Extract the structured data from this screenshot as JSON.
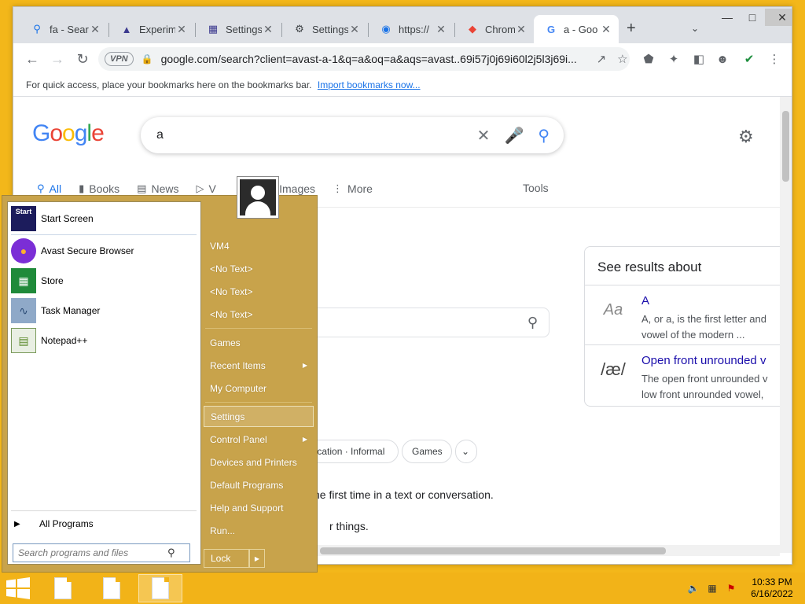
{
  "browser": {
    "tabs": [
      {
        "title": "fa - Sear",
        "icon": "search-icon"
      },
      {
        "title": "Experim",
        "icon": "flask-icon"
      },
      {
        "title": "Settings",
        "icon": "settings-page-icon"
      },
      {
        "title": "Settings",
        "icon": "gear-icon"
      },
      {
        "title": "https://",
        "icon": "globe-icon"
      },
      {
        "title": "Chrome",
        "icon": "chrome-store-icon"
      },
      {
        "title": "a - Goo",
        "icon": "google-icon"
      }
    ],
    "url": "google.com/search?client=avast-a-1&q=a&oq=a&aqs=avast..69i57j0j69i60l2j5l3j69i...",
    "vpn_label": "VPN",
    "bookmark_bar_text": "For quick access, place your bookmarks here on the bookmarks bar.",
    "bookmark_bar_link": "Import bookmarks now..."
  },
  "google": {
    "logo": [
      "G",
      "o",
      "o",
      "g",
      "l",
      "e"
    ],
    "logo_colors": [
      "#4285f4",
      "#ea4335",
      "#fbbc05",
      "#4285f4",
      "#34a853",
      "#ea4335"
    ],
    "query": "a",
    "tabs": [
      {
        "label": "All",
        "icon": "search-icon"
      },
      {
        "label": "Books",
        "icon": "book-icon"
      },
      {
        "label": "News",
        "icon": "news-icon"
      },
      {
        "label": "V",
        "icon": "video-icon"
      },
      {
        "label": "Images",
        "icon": "image-icon"
      },
      {
        "label": "More",
        "icon": "more-vert-icon"
      }
    ],
    "tools": "Tools",
    "knowledge_panel": {
      "title": "See results about",
      "items": [
        {
          "name": "A",
          "desc1": "A, or a, is the first letter and",
          "desc2": "vowel of the modern ...",
          "thumb": "Aa"
        },
        {
          "name": "Open front unrounded v",
          "desc1": "The open front unrounded v",
          "desc2": "low front unrounded vowel,",
          "thumb": "/æ/"
        }
      ]
    },
    "chips": [
      {
        "label": "Education · Informal"
      },
      {
        "label": "Games"
      }
    ],
    "text_lines": [
      "he first time in a text or conversation.",
      "r things."
    ]
  },
  "startmenu": {
    "pinned": [
      {
        "label": "Start Screen",
        "icon": "start-screen-icon",
        "badge": "Start"
      },
      {
        "label": "Avast Secure Browser",
        "icon": "avast-browser-icon"
      },
      {
        "label": "Store",
        "icon": "store-icon"
      },
      {
        "label": "Task Manager",
        "icon": "task-manager-icon"
      },
      {
        "label": "Notepad++",
        "icon": "notepadpp-icon"
      }
    ],
    "all_programs": "All Programs",
    "search_placeholder": "Search programs and files",
    "right_items": [
      {
        "label": "VM4",
        "arrow": false
      },
      {
        "label": "<No Text>",
        "arrow": false
      },
      {
        "label": "<No Text>",
        "arrow": false
      },
      {
        "label": "<No Text>",
        "arrow": false
      },
      {
        "label": "Games",
        "arrow": false
      },
      {
        "label": "Recent Items",
        "arrow": true
      },
      {
        "label": "My Computer",
        "arrow": false
      },
      {
        "label": "Settings",
        "arrow": false
      },
      {
        "label": "Control Panel",
        "arrow": true
      },
      {
        "label": "Devices and Printers",
        "arrow": false
      },
      {
        "label": "Default Programs",
        "arrow": false
      },
      {
        "label": "Help and Support",
        "arrow": false
      },
      {
        "label": "Run...",
        "arrow": false
      }
    ],
    "lock_label": "Lock"
  },
  "taskbar": {
    "time": "10:33 PM",
    "date": "6/16/2022"
  }
}
